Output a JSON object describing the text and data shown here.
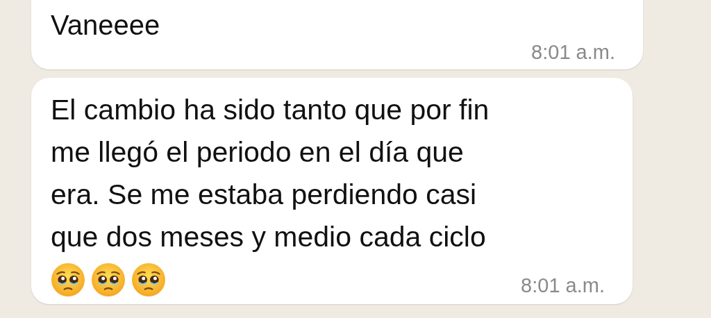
{
  "messages": [
    {
      "sender": "Vaneeee",
      "time": "8:01 a.m."
    },
    {
      "text": "El cambio ha sido tanto que por fin\nme llegó el periodo en el día que\nera. Se me estaba perdiendo casi\nque dos meses y medio cada ciclo",
      "time": "8:01 a.m."
    }
  ]
}
